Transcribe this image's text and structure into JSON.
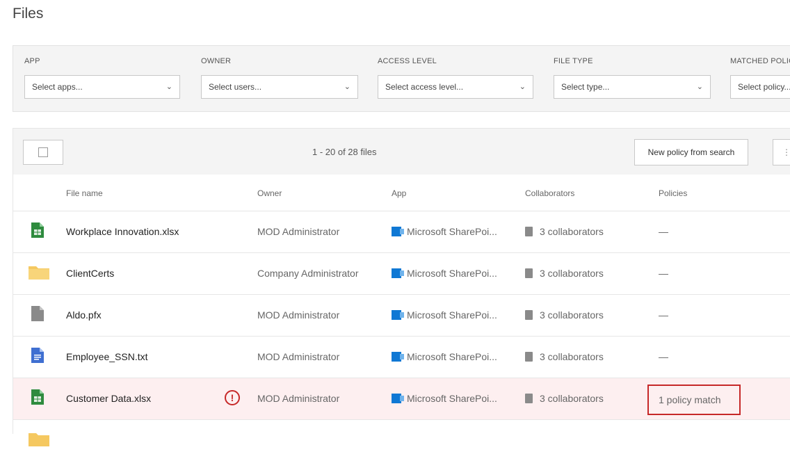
{
  "page_title": "Files",
  "filters": [
    {
      "label": "APP",
      "placeholder": "Select apps..."
    },
    {
      "label": "OWNER",
      "placeholder": "Select users..."
    },
    {
      "label": "ACCESS LEVEL",
      "placeholder": "Select access level..."
    },
    {
      "label": "FILE TYPE",
      "placeholder": "Select type..."
    },
    {
      "label": "MATCHED POLICY",
      "placeholder": "Select policy..."
    }
  ],
  "toolbar": {
    "count_text": "1 - 20 of 28 files",
    "new_policy_label": "New policy from search"
  },
  "columns": {
    "file_name": "File name",
    "owner": "Owner",
    "app": "App",
    "collaborators": "Collaborators",
    "policies": "Policies"
  },
  "files": [
    {
      "name": "Workplace Innovation.xlsx",
      "type": "spreadsheet",
      "owner": "MOD Administrator",
      "app": "Microsoft SharePoi...",
      "collaborators": "3 collaborators",
      "policies": "—"
    },
    {
      "name": "ClientCerts",
      "type": "folder",
      "owner": "Company Administrator",
      "app": "Microsoft SharePoi...",
      "collaborators": "3 collaborators",
      "policies": "—"
    },
    {
      "name": "Aldo.pfx",
      "type": "generic",
      "owner": "MOD Administrator",
      "app": "Microsoft SharePoi...",
      "collaborators": "3 collaborators",
      "policies": "—"
    },
    {
      "name": "Employee_SSN.txt",
      "type": "document",
      "owner": "MOD Administrator",
      "app": "Microsoft SharePoi...",
      "collaborators": "3 collaborators",
      "policies": "—"
    },
    {
      "name": "Customer Data.xlsx",
      "type": "spreadsheet",
      "owner": "MOD Administrator",
      "app": "Microsoft SharePoi...",
      "collaborators": "3 collaborators",
      "policies": "1 policy match",
      "alert": "!"
    }
  ],
  "colors": {
    "alert": "#c62828",
    "highlight_row": "#fdeff0",
    "spreadsheet_icon": "#2e8b3e",
    "folder_icon": "#f5c860",
    "document_icon": "#3f6fd1",
    "generic_icon": "#8a8a8a",
    "app_icon": "#0f78d4"
  }
}
